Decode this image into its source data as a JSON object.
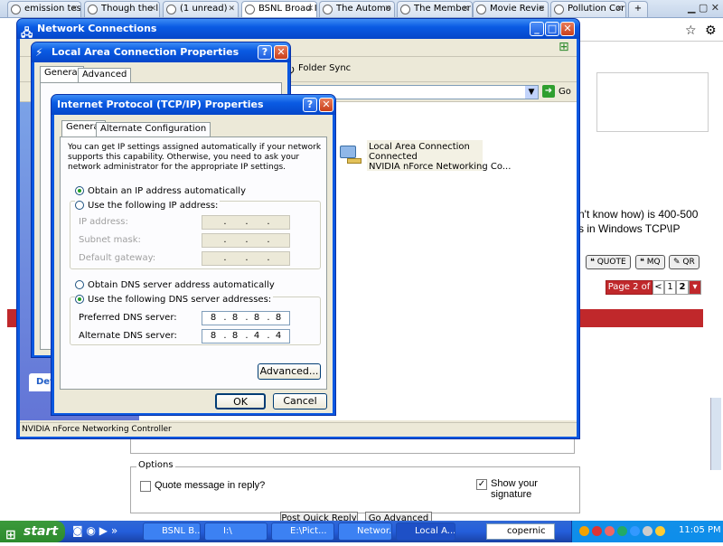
{
  "browser_tabs": [
    {
      "label": "emission test",
      "active": false
    },
    {
      "label": "Though the l",
      "active": false
    },
    {
      "label": "(1 unread) -",
      "active": false
    },
    {
      "label": "BSNL Broad I",
      "active": true
    },
    {
      "label": "The Automo",
      "active": false
    },
    {
      "label": "The Member",
      "active": false
    },
    {
      "label": "Movie Revie",
      "active": false
    },
    {
      "label": "Pollution Cor",
      "active": false
    }
  ],
  "webpage": {
    "post_text_1": "n't know how) is 400-500",
    "post_text_2": "s in Windows TCP\\IP",
    "quote_btn": "QUOTE",
    "mq_btn": "MQ",
    "qr_btn": "QR",
    "pager": {
      "label": "Page 2 of 2",
      "prev": "<",
      "p1": "1",
      "p2": "2"
    },
    "options_legend": "Options",
    "quote_message": "Quote message in reply?",
    "show_signature": "Show your signature",
    "post_quick_reply": "Post Quick Reply",
    "go_advanced": "Go Advanced",
    "left_tab": "Det"
  },
  "network_window": {
    "title": "Network Connections",
    "folder_sync": "Folder Sync",
    "go": "Go",
    "lan_name": "Local Area Connection",
    "lan_status": "Connected",
    "lan_adapter": "NVIDIA nForce Networking Co...",
    "status_bar": "NVIDIA nForce Networking Controller"
  },
  "lan_props": {
    "title": "Local Area Connection Properties",
    "tab_general": "General",
    "tab_advanced": "Advanced"
  },
  "tcpip": {
    "title": "Internet Protocol (TCP/IP) Properties",
    "tab_general": "General",
    "tab_alt": "Alternate Configuration",
    "intro": "You can get IP settings assigned automatically if your network supports this capability. Otherwise, you need to ask your network administrator for the appropriate IP settings.",
    "radio_auto_ip": "Obtain an IP address automatically",
    "radio_manual_ip": "Use the following IP address:",
    "ip_label": "IP address:",
    "mask_label": "Subnet mask:",
    "gateway_label": "Default gateway:",
    "radio_auto_dns": "Obtain DNS server address automatically",
    "radio_manual_dns": "Use the following DNS server addresses:",
    "pref_dns_label": "Preferred DNS server:",
    "alt_dns_label": "Alternate DNS server:",
    "pref_dns": [
      "8",
      "8",
      "8",
      "8"
    ],
    "alt_dns": [
      "8",
      "8",
      "4",
      "4"
    ],
    "advanced_btn": "Advanced...",
    "ok_btn": "OK",
    "cancel_btn": "Cancel"
  },
  "taskbar": {
    "start": "start",
    "buttons": [
      "BSNL B...",
      "I:\\",
      "E:\\Pict...",
      "Networ...",
      "Local A...",
      "copernic"
    ],
    "clock": "11:05 PM"
  },
  "colors": {
    "xp_blue": "#0a58e0",
    "forum_red": "#c0282b",
    "taskbar": "#245edb"
  }
}
